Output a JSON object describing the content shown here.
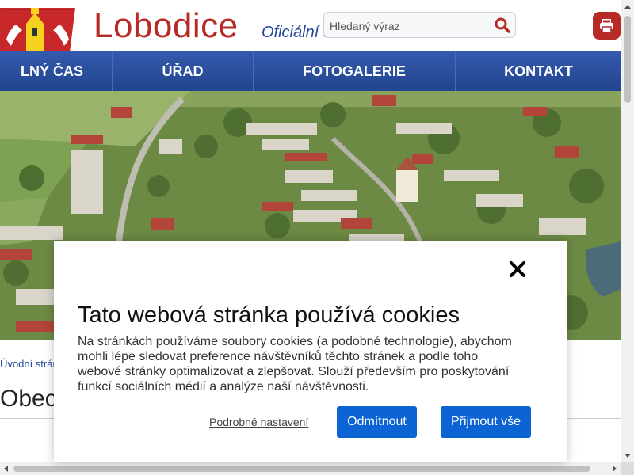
{
  "header": {
    "site_title": "Lobodice",
    "site_subtitle": "Oficiální s",
    "search": {
      "placeholder": "Hledaný výraz"
    },
    "print_label": "Tisk"
  },
  "nav": {
    "items": [
      {
        "label": "LNÝ ČAS"
      },
      {
        "label": "ÚŘAD"
      },
      {
        "label": "FOTOGALERIE"
      },
      {
        "label": "KONTAKT"
      }
    ]
  },
  "breadcrumb": {
    "label": "Úvodní strán"
  },
  "page": {
    "heading": "Obec"
  },
  "cookie_dialog": {
    "title": "Tato webová stránka používá cookies",
    "text": "Na stránkách používáme soubory cookies (a podobné technologie), abychom mohli lépe sledovat preference návštěvníků těchto stránek a podle toho webové stránky optimalizovat a zlepšovat. Slouží především pro poskytování funkcí sociálních médií a analýze naší návštěvnosti.",
    "settings_label": "Podrobné nastavení",
    "reject_label": "Odmítnout",
    "accept_label": "Přijmout vše"
  },
  "icons": {
    "search": "search-icon",
    "print": "printer-icon",
    "close": "close-icon",
    "crest": "coat-of-arms-icon"
  },
  "colors": {
    "brand_red": "#b72a26",
    "nav_blue": "#2a4fa0",
    "button_blue": "#0b63d4"
  }
}
